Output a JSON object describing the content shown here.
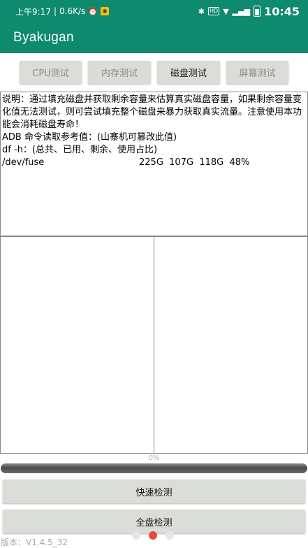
{
  "status_bar": {
    "time_prefix": "上午9:17",
    "network_speed": "0.6K/s",
    "clock": "10:45",
    "icons": [
      "alarm-icon",
      "wechat-icon",
      "bluetooth-icon",
      "hd-icon",
      "wifi-icon",
      "signal-icon",
      "battery-icon"
    ]
  },
  "app": {
    "title": "Byakugan",
    "accent_color": "#0e8a6e"
  },
  "tabs": [
    {
      "label": "CPU测试",
      "active": false
    },
    {
      "label": "内存测试",
      "active": false
    },
    {
      "label": "磁盘测试",
      "active": true
    },
    {
      "label": "屏幕测试",
      "active": false
    }
  ],
  "info": {
    "description": "说明：通过填充磁盘并获取剩余容量来估算真实磁盘容量，如果剩余容量变化值无法测试，则可尝试填充整个磁盘来暴力获取真实流量。注意使用本功能会消耗磁盘寿命！",
    "adb_line": "ADB 命令读取参考值：(山寨机可篡改此值)",
    "df_line": "df -h：(总共、已用、剩余、使用占比)",
    "fuse_device": "/dev/fuse",
    "fuse_values": "225G  107G  118G  48%"
  },
  "progress": {
    "label": "0%",
    "value": 0
  },
  "buttons": {
    "quick": "快速检测",
    "full": "全盘检测"
  },
  "version": "版本：V1.4.5_32",
  "pager": {
    "count": 3,
    "active_index": 1
  }
}
